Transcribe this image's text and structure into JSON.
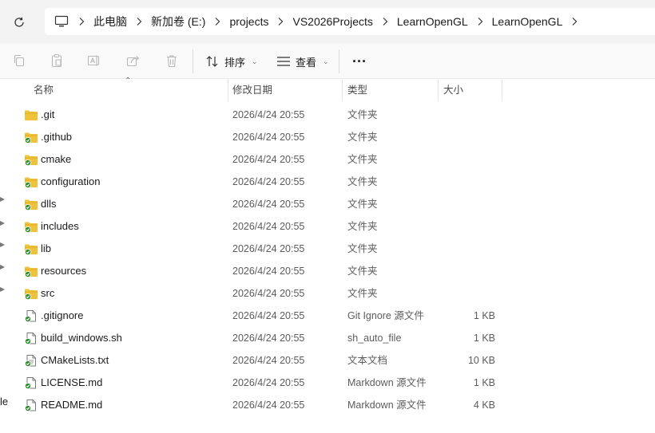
{
  "address": {
    "breadcrumbs": [
      "此电脑",
      "新加卷 (E:)",
      "projects",
      "VS2026Projects",
      "LearnOpenGL",
      "LearnOpenGL"
    ]
  },
  "toolbar": {
    "sort_label": "排序",
    "view_label": "查看",
    "more_label": "···"
  },
  "columns": {
    "name": "名称",
    "date": "修改日期",
    "type": "类型",
    "size": "大小"
  },
  "files": [
    {
      "name": ".git",
      "date": "2026/4/24 20:55",
      "type": "文件夹",
      "size": "",
      "kind": "folder",
      "synced": false
    },
    {
      "name": ".github",
      "date": "2026/4/24 20:55",
      "type": "文件夹",
      "size": "",
      "kind": "folder",
      "synced": true
    },
    {
      "name": "cmake",
      "date": "2026/4/24 20:55",
      "type": "文件夹",
      "size": "",
      "kind": "folder",
      "synced": true
    },
    {
      "name": "configuration",
      "date": "2026/4/24 20:55",
      "type": "文件夹",
      "size": "",
      "kind": "folder",
      "synced": true
    },
    {
      "name": "dlls",
      "date": "2026/4/24 20:55",
      "type": "文件夹",
      "size": "",
      "kind": "folder",
      "synced": true
    },
    {
      "name": "includes",
      "date": "2026/4/24 20:55",
      "type": "文件夹",
      "size": "",
      "kind": "folder",
      "synced": true
    },
    {
      "name": "lib",
      "date": "2026/4/24 20:55",
      "type": "文件夹",
      "size": "",
      "kind": "folder",
      "synced": true
    },
    {
      "name": "resources",
      "date": "2026/4/24 20:55",
      "type": "文件夹",
      "size": "",
      "kind": "folder",
      "synced": true
    },
    {
      "name": "src",
      "date": "2026/4/24 20:55",
      "type": "文件夹",
      "size": "",
      "kind": "folder",
      "synced": true
    },
    {
      "name": ".gitignore",
      "date": "2026/4/24 20:55",
      "type": "Git Ignore 源文件",
      "size": "1 KB",
      "kind": "file",
      "synced": true
    },
    {
      "name": "build_windows.sh",
      "date": "2026/4/24 20:55",
      "type": "sh_auto_file",
      "size": "1 KB",
      "kind": "file",
      "synced": true
    },
    {
      "name": "CMakeLists.txt",
      "date": "2026/4/24 20:55",
      "type": "文本文档",
      "size": "10 KB",
      "kind": "text",
      "synced": true
    },
    {
      "name": "LICENSE.md",
      "date": "2026/4/24 20:55",
      "type": "Markdown 源文件",
      "size": "1 KB",
      "kind": "file",
      "synced": true
    },
    {
      "name": "README.md",
      "date": "2026/4/24 20:55",
      "type": "Markdown 源文件",
      "size": "4 KB",
      "kind": "file",
      "synced": true
    }
  ],
  "nav_fragment": "le",
  "colors": {
    "folder": "#f0c23a",
    "sync_green": "#2e8b2e",
    "accent": "#0067c0"
  }
}
